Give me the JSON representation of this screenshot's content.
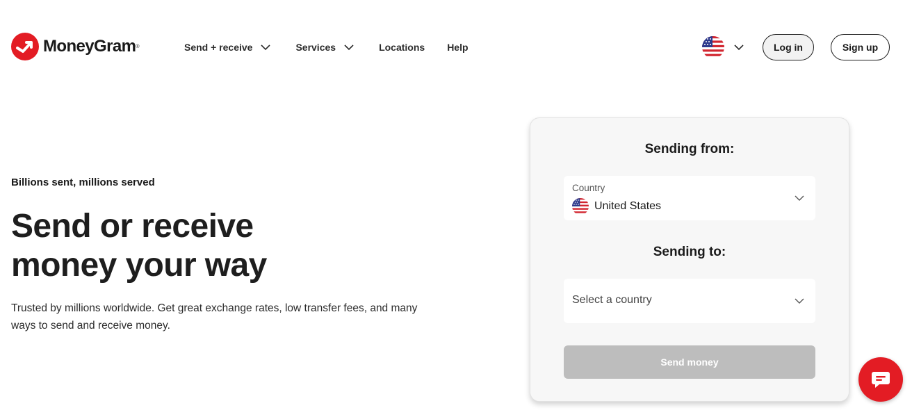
{
  "brand": {
    "name": "MoneyGram",
    "registered_mark": "®",
    "color": "#e31c24"
  },
  "nav": {
    "items": [
      {
        "label": "Send + receive",
        "has_dropdown": true
      },
      {
        "label": "Services",
        "has_dropdown": true
      },
      {
        "label": "Locations",
        "has_dropdown": false
      },
      {
        "label": "Help",
        "has_dropdown": false
      }
    ]
  },
  "header": {
    "language_flag_icon": "us-flag-icon",
    "login_label": "Log in",
    "signup_label": "Sign up"
  },
  "hero": {
    "tagline": "Billions sent, millions served",
    "headline_line1": "Send or receive",
    "headline_line2": "money your way",
    "subtext": "Trusted by millions worldwide. Get great exchange rates, low transfer fees, and many ways to send and receive money."
  },
  "transfer_card": {
    "sending_from_heading": "Sending from:",
    "from_field": {
      "label": "Country",
      "value": "United States",
      "flag_icon": "us-flag-icon"
    },
    "sending_to_heading": "Sending to:",
    "to_field": {
      "placeholder": "Select a country"
    },
    "send_button_label": "Send money",
    "send_button_color": "#bdbdbd"
  },
  "chat": {
    "icon": "chat-icon"
  }
}
